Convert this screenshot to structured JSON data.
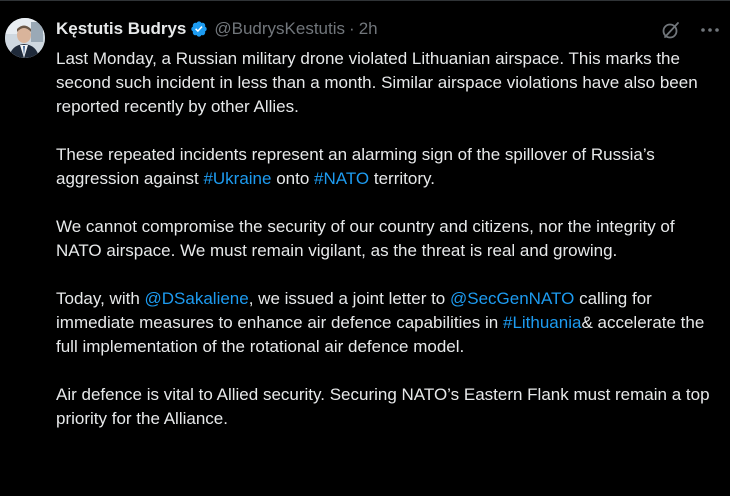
{
  "author": {
    "name": "Kęstutis Budrys",
    "handle": "@BudrysKestutis",
    "separator": "·",
    "time": "2h",
    "verified_icon": "verified-badge-icon",
    "avatar_icon": "profile-avatar"
  },
  "actions": {
    "grok_icon": "grok-icon",
    "more_icon": "more-options-icon"
  },
  "tweet": {
    "p1": "Last Monday, a Russian military drone violated Lithuanian airspace. This marks the second such incident in less than a month. Similar airspace violations have also been reported recently by other Allies.",
    "p2_before_1": "These repeated incidents represent an alarming sign of the spillover of Russia’s aggression against ",
    "p2_hashtag_1": "#Ukraine",
    "p2_between": " onto ",
    "p2_hashtag_2": "#NATO",
    "p2_after": " territory.",
    "p3": "We cannot compromise the security of our country and citizens, nor the integrity of NATO airspace. We must remain vigilant, as the threat is real and growing.",
    "p4_before_mention_1": "Today, with ",
    "p4_mention_1": "@DSakaliene",
    "p4_between_1": ", we issued a joint letter to ",
    "p4_mention_2": "@SecGenNATO",
    "p4_between_2": " calling for immediate measures to enhance air defence capabilities in ",
    "p4_hashtag": "#Lithuania",
    "p4_after": "& accelerate the full implementation of the rotational air defence model.",
    "p5": "Air defence is vital to Allied security. Securing NATO’s Eastern Flank must remain a top priority for the Alliance."
  },
  "colors": {
    "background": "#000000",
    "text": "#e7e9ea",
    "muted": "#71767b",
    "link": "#1d9bf0",
    "verified": "#1d9bf0"
  }
}
